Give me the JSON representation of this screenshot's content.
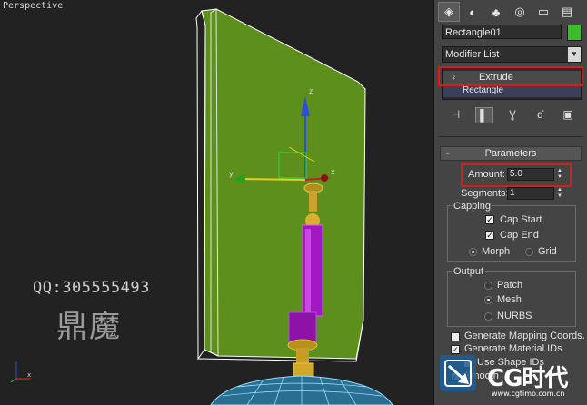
{
  "viewport": {
    "label": "Perspective",
    "watermark_qq": "QQ:305555493",
    "watermark_cn": "鼎魔",
    "gizmo_axes": {
      "z": "z",
      "y": "y",
      "x": "x"
    }
  },
  "command_panel": {
    "tabs": [
      {
        "icon": "create-icon",
        "active": true
      },
      {
        "icon": "modify-icon",
        "active": false
      },
      {
        "icon": "hierarchy-icon",
        "active": false
      },
      {
        "icon": "motion-icon",
        "active": false
      },
      {
        "icon": "display-icon",
        "active": false
      },
      {
        "icon": "utilities-icon",
        "active": false
      }
    ],
    "object_name": "Rectangle01",
    "object_color": "#3cbe2a",
    "modifier_list": "Modifier List",
    "stack": {
      "selected": "Extrude",
      "base": "Rectangle"
    },
    "rollout_title": "Parameters",
    "amount_label": "Amount:",
    "amount_value": "5.0",
    "segments_label": "Segments:",
    "segments_value": "1",
    "capping": {
      "title": "Capping",
      "cap_start": "Cap Start",
      "cap_end": "Cap End",
      "morph": "Morph",
      "grid": "Grid"
    },
    "output": {
      "title": "Output",
      "patch": "Patch",
      "mesh": "Mesh",
      "nurbs": "NURBS"
    },
    "gen_mapping": "Generate Mapping Coords.",
    "gen_material": "Generate Material IDs",
    "use_shape": "Use Shape IDs",
    "smooth": "Smooth"
  },
  "branding": {
    "logo_text": "CG时代",
    "url": "www.cgtimo.com.cn"
  },
  "colors": {
    "highlight": "#e01818",
    "panel": "#444444",
    "viewport": "#222222"
  }
}
